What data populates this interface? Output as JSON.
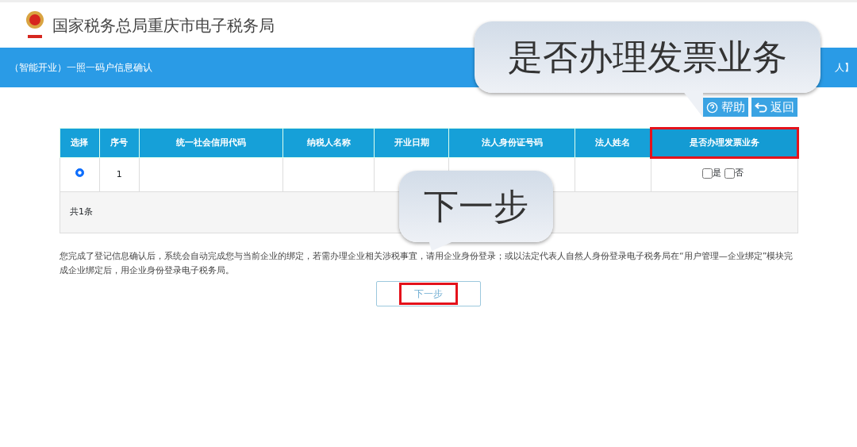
{
  "header": {
    "title": "国家税务总局重庆市电子税务局"
  },
  "banner": {
    "title": "（智能开业）一照一码户信息确认",
    "right_text": "人】"
  },
  "toolbar": {
    "help": "帮助",
    "back": "返回"
  },
  "table": {
    "columns": [
      {
        "label": "选择",
        "highlighted": false
      },
      {
        "label": "序号",
        "highlighted": false
      },
      {
        "label": "统一社会信用代码",
        "highlighted": false
      },
      {
        "label": "纳税人名称",
        "highlighted": false
      },
      {
        "label": "开业日期",
        "highlighted": false
      },
      {
        "label": "法人身份证号码",
        "highlighted": false
      },
      {
        "label": "法人姓名",
        "highlighted": false
      },
      {
        "label": "是否办理发票业务",
        "highlighted": true
      }
    ],
    "rows": [
      {
        "selected": true,
        "index": "1",
        "invoice_options": [
          {
            "label": "是",
            "checked": false
          },
          {
            "label": "否",
            "checked": false
          }
        ]
      }
    ],
    "footer": "共1条"
  },
  "notice": "您完成了登记信息确认后，系统会自动完成您与当前企业的绑定，若需办理企业相关涉税事宜，请用企业身份登录；或以法定代表人自然人身份登录电子税务局在“用户管理—企业绑定”模块完成企业绑定后，用企业身份登录电子税务局。",
  "next_button": {
    "label": "下一步",
    "highlighted": true
  },
  "callouts": [
    "是否办理发票业务",
    "下一步"
  ]
}
